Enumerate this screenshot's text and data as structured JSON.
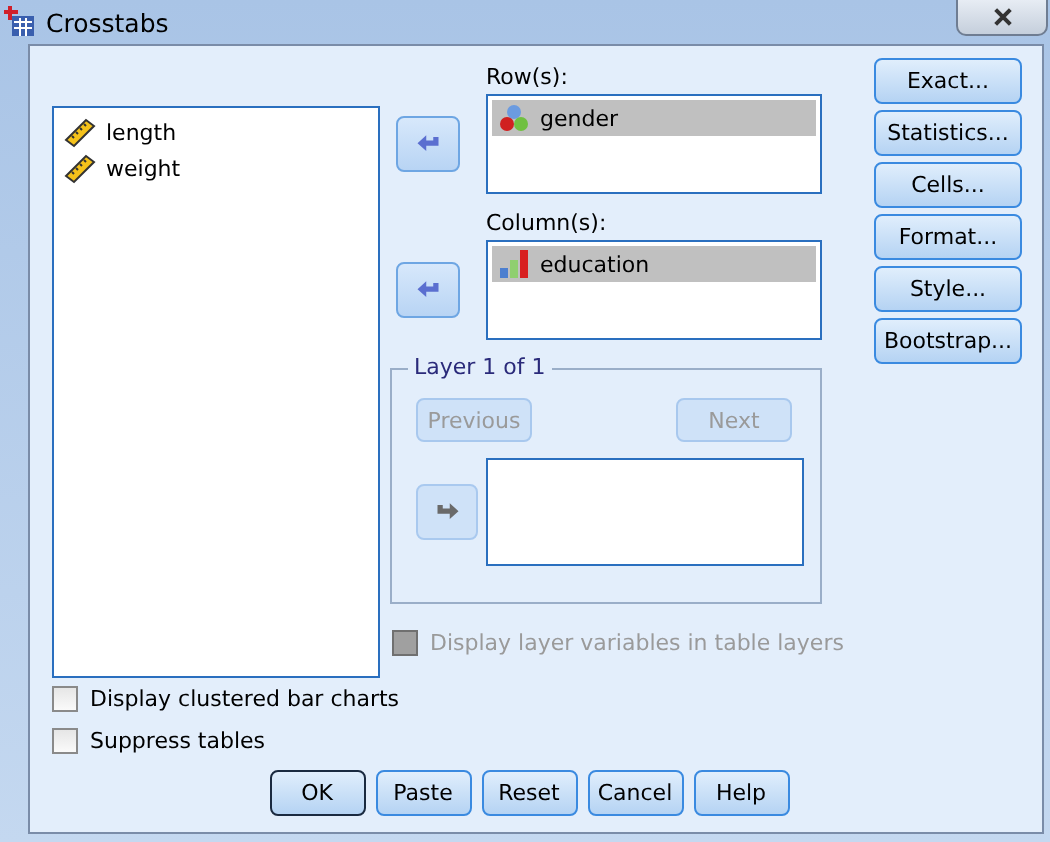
{
  "window": {
    "title": "Crosstabs"
  },
  "source_list": [
    {
      "name": "length",
      "kind": "scale",
      "selected": false
    },
    {
      "name": "weight",
      "kind": "scale",
      "selected": false
    }
  ],
  "rows": {
    "label": "Row(s):",
    "items": [
      {
        "name": "gender",
        "kind": "nominal",
        "selected": true
      }
    ]
  },
  "columns": {
    "label": "Column(s):",
    "items": [
      {
        "name": "education",
        "kind": "ordinal",
        "selected": true
      }
    ]
  },
  "layer": {
    "title": "Layer 1 of 1",
    "previous": {
      "label": "Previous",
      "disabled": true
    },
    "next": {
      "label": "Next",
      "disabled": true
    },
    "move_disabled": true
  },
  "side_buttons": [
    "Exact...",
    "Statistics...",
    "Cells...",
    "Format...",
    "Style...",
    "Bootstrap..."
  ],
  "options": [
    {
      "label": "Display layer variables in table layers",
      "checked": false,
      "disabled": true
    },
    {
      "label": "Display clustered bar charts",
      "checked": false,
      "disabled": false
    },
    {
      "label": "Suppress tables",
      "checked": false,
      "disabled": false
    }
  ],
  "buttons": [
    {
      "label": "OK",
      "default": true
    },
    {
      "label": "Paste",
      "default": false
    },
    {
      "label": "Reset",
      "default": false
    },
    {
      "label": "Cancel",
      "default": false
    },
    {
      "label": "Help",
      "default": false
    }
  ]
}
